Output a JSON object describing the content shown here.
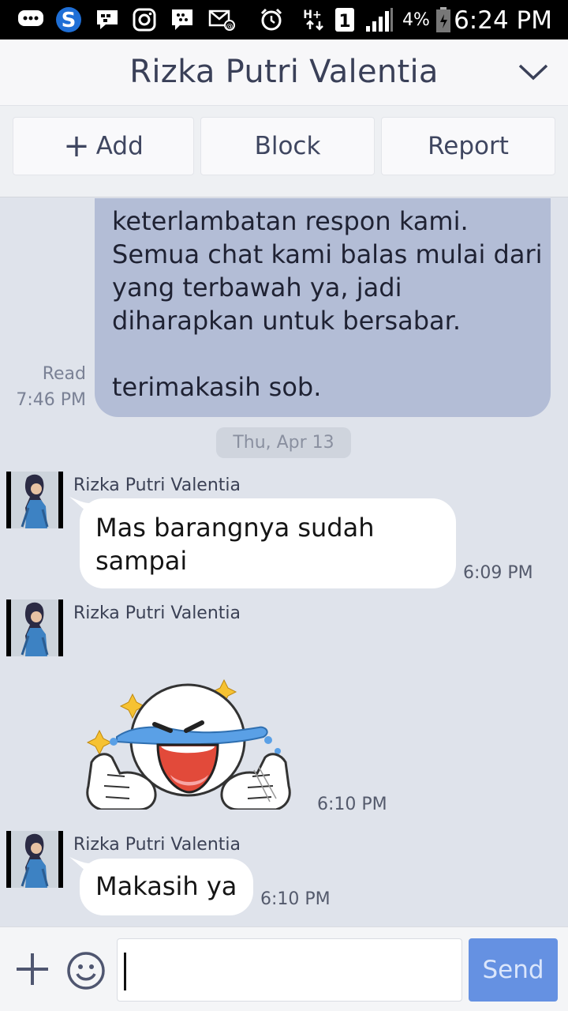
{
  "status_bar": {
    "time": "6:24 PM",
    "battery_percent": "4%",
    "sim_slot": "1",
    "network": "H+",
    "icons": [
      "bbm-chat-icon",
      "s-app-icon",
      "bbm-icon",
      "instagram-icon",
      "blackberry-icon",
      "email-icon",
      "alarm-icon",
      "data-icon",
      "signal-icon",
      "battery-icon"
    ]
  },
  "header": {
    "title": "Rizka Putri Valentia",
    "chevron_icon": "chevron-down-icon"
  },
  "actions": {
    "add_label": "Add",
    "block_label": "Block",
    "report_label": "Report"
  },
  "messages": {
    "outgoing": {
      "lines": [
        "keterlambatan respon kami.",
        "Semua chat kami balas mulai dari",
        "yang terbawah ya, jadi",
        "diharapkan untuk bersabar.",
        "",
        "terimakasih sob."
      ],
      "read_label": "Read",
      "time": "7:46 PM"
    },
    "date_divider": "Thu, Apr 13",
    "incoming": [
      {
        "sender": "Rizka Putri Valentia",
        "lines": [
          "Mas barangnya sudah",
          "sampai"
        ],
        "time": "6:09 PM"
      },
      {
        "sender": "Rizka Putri Valentia",
        "sticker": "laughing-crying-thumbs-up-sticker",
        "time": "6:10 PM"
      },
      {
        "sender": "Rizka Putri Valentia",
        "lines": [
          "Makasih ya"
        ],
        "time": "6:10 PM"
      }
    ]
  },
  "input_bar": {
    "value": "",
    "send_label": "Send"
  },
  "colors": {
    "outgoing_bubble": "#b3bdd6",
    "chat_background": "#dfe3eb",
    "send_button": "#6591e2"
  }
}
